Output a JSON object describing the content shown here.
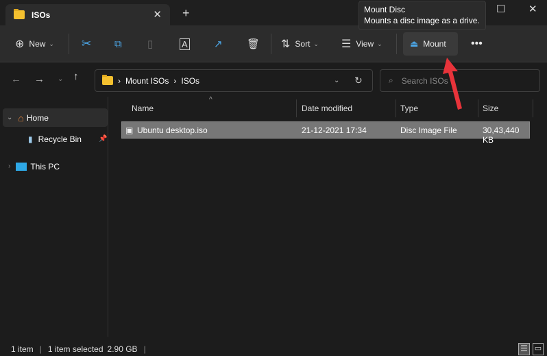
{
  "tab": {
    "title": "ISOs"
  },
  "tooltip": {
    "title": "Mount Disc",
    "description": "Mounts a disc image as a drive."
  },
  "toolbar": {
    "new": "New",
    "sort": "Sort",
    "view": "View",
    "mount": "Mount"
  },
  "address": {
    "crumbs": [
      "Mount ISOs",
      "ISOs"
    ]
  },
  "search": {
    "placeholder": "Search ISOs"
  },
  "sidebar": {
    "items": [
      {
        "label": "Home"
      },
      {
        "label": "Recycle Bin"
      },
      {
        "label": "This PC"
      }
    ]
  },
  "columns": {
    "name": "Name",
    "date": "Date modified",
    "type": "Type",
    "size": "Size"
  },
  "files": [
    {
      "name": "Ubuntu desktop.iso",
      "date": "21-12-2021 17:34",
      "type": "Disc Image File",
      "size": "30,43,440 KB"
    }
  ],
  "status": {
    "count": "1 item",
    "selected": "1 item selected",
    "size": "2.90 GB"
  },
  "colors": {
    "accent": "#e8333a",
    "selected_row": "#777777"
  }
}
